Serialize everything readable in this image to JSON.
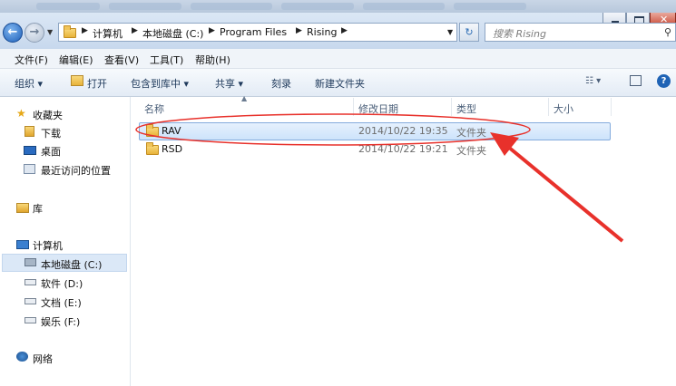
{
  "breadcrumb": [
    "计算机",
    "本地磁盘 (C:)",
    "Program Files",
    "Rising"
  ],
  "search": {
    "placeholder": "搜索 Rising"
  },
  "menu": [
    "文件(F)",
    "编辑(E)",
    "查看(V)",
    "工具(T)",
    "帮助(H)"
  ],
  "toolbar": {
    "organize": "组织 ▾",
    "open": "打开",
    "include": "包含到库中 ▾",
    "share": "共享 ▾",
    "burn": "刻录",
    "new_folder": "新建文件夹"
  },
  "nav": {
    "favorites": "收藏夹",
    "downloads": "下载",
    "desktop": "桌面",
    "recent": "最近访问的位置",
    "libraries": "库",
    "computer": "计算机",
    "local_disk": "本地磁盘 (C:)",
    "drive_d": "软件 (D:)",
    "drive_e": "文档 (E:)",
    "drive_f": "娱乐 (F:)",
    "network": "网络"
  },
  "columns": {
    "name": "名称",
    "date": "修改日期",
    "type": "类型",
    "size": "大小"
  },
  "files": [
    {
      "name": "RAV",
      "date": "2014/10/22 19:35",
      "type": "文件夹",
      "size": ""
    },
    {
      "name": "RSD",
      "date": "2014/10/22 19:21",
      "type": "文件夹",
      "size": ""
    }
  ],
  "colors": {
    "annotation": "#e8312b",
    "selection": "#cde3fb"
  }
}
